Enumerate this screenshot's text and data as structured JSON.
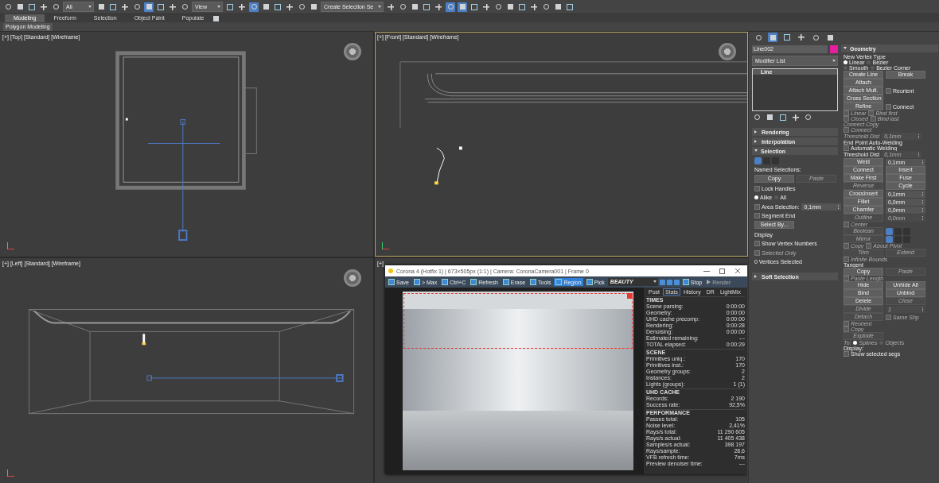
{
  "toolbar": {
    "selection_filter": "All",
    "reference_coord": "View",
    "named_selection": "Create Selection Se"
  },
  "ribbon": {
    "tabs": [
      {
        "label": "Modeling",
        "selected": true
      },
      {
        "label": "Freeform",
        "selected": false
      },
      {
        "label": "Selection",
        "selected": false
      },
      {
        "label": "Object Paint",
        "selected": false
      },
      {
        "label": "Populate",
        "selected": false
      }
    ],
    "panel": "Polygon Modeling"
  },
  "viewports": [
    {
      "kind": "top",
      "label": "[+] [Top] [Standard] [Wireframe]",
      "active": false
    },
    {
      "kind": "front",
      "label": "[+] [Front] [Standard] [Wireframe]",
      "active": true
    },
    {
      "kind": "left",
      "label": "[+] [Left] [Standard] [Wireframe]",
      "active": false
    },
    {
      "kind": "camera",
      "label": "[+]",
      "active": false
    }
  ],
  "command_panel": {
    "object_name": "Line002",
    "modifier_list": "Modifier List",
    "stack": [
      {
        "label": "Line",
        "selected": true
      }
    ],
    "rollouts_left": [
      {
        "title": "Rendering",
        "expanded": false
      },
      {
        "title": "Interpolation",
        "expanded": false
      },
      {
        "title": "Selection",
        "expanded": true,
        "rows": [
          {
            "items": [
              {
                "kind": "icons"
              }
            ]
          },
          {
            "items": [
              {
                "kind": "label",
                "text": "Named Selections:",
                "disabled": false
              }
            ]
          },
          {
            "items": [
              {
                "kind": "button",
                "text": "Copy",
                "disabled": false
              },
              {
                "kind": "button",
                "text": "Paste",
                "disabled": true
              }
            ]
          },
          {
            "items": [
              {
                "kind": "checkbox",
                "text": "Lock Handles",
                "checked": false,
                "disabled": false
              }
            ]
          },
          {
            "items": [
              {
                "kind": "radio",
                "text": "Alike",
                "selected": true,
                "disabled": false
              },
              {
                "kind": "radio",
                "text": "All",
                "selected": false,
                "disabled": false
              }
            ]
          },
          {
            "items": [
              {
                "kind": "checkbox",
                "text": "Area Selection:",
                "checked": false,
                "disabled": false
              },
              {
                "kind": "spinner",
                "text": "0,1mm",
                "disabled": false
              }
            ]
          },
          {
            "items": [
              {
                "kind": "checkbox",
                "text": "Segment End",
                "checked": false,
                "disabled": false
              }
            ]
          },
          {
            "items": [
              {
                "kind": "button",
                "text": "Select By...",
                "disabled": false
              }
            ]
          },
          {
            "items": [
              {
                "kind": "label",
                "text": "Display",
                "disabled": false
              }
            ]
          },
          {
            "items": [
              {
                "kind": "checkbox",
                "text": "Show Vertex Numbers",
                "checked": false,
                "disabled": false
              }
            ]
          },
          {
            "items": [
              {
                "kind": "checkbox",
                "text": "Selected Only",
                "checked": false,
                "disabled": true
              }
            ]
          },
          {
            "items": [
              {
                "kind": "label",
                "text": "0 Vertices Selected",
                "disabled": false
              }
            ]
          }
        ]
      },
      {
        "title": "Soft Selection",
        "expanded": false
      }
    ],
    "geometry": {
      "title": "Geometry",
      "expanded": true,
      "rows": [
        {
          "items": [
            {
              "kind": "label",
              "text": "New Vertex Type",
              "disabled": false
            }
          ]
        },
        {
          "items": [
            {
              "kind": "radio",
              "text": "Linear",
              "selected": true,
              "disabled": false
            },
            {
              "kind": "radio",
              "text": "Bezier",
              "selected": false,
              "disabled": false
            }
          ]
        },
        {
          "items": [
            {
              "kind": "radio",
              "text": "Smooth",
              "selected": false,
              "disabled": false
            },
            {
              "kind": "radio",
              "text": "Bezier Corner",
              "selected": false,
              "disabled": false
            }
          ]
        },
        {
          "items": [
            {
              "kind": "button",
              "text": "Create Line",
              "disabled": false
            },
            {
              "kind": "button",
              "text": "Break",
              "disabled": false
            }
          ]
        },
        {
          "items": [
            {
              "kind": "button",
              "text": "Attach",
              "disabled": false
            }
          ]
        },
        {
          "items": [
            {
              "kind": "button",
              "text": "Attach Mult.",
              "disabled": false
            },
            {
              "kind": "checkbox",
              "text": "Reorient",
              "checked": false,
              "disabled": false
            }
          ]
        },
        {
          "items": [
            {
              "kind": "button",
              "text": "Cross Section",
              "disabled": false
            }
          ]
        },
        {
          "items": [
            {
              "kind": "button",
              "text": "Refine",
              "disabled": false
            },
            {
              "kind": "checkbox",
              "text": "Connect",
              "checked": false,
              "disabled": false
            }
          ]
        },
        {
          "items": [
            {
              "kind": "checkbox",
              "text": "Linear",
              "checked": false,
              "disabled": true
            },
            {
              "kind": "checkbox",
              "text": "Bind first",
              "checked": false,
              "disabled": true
            }
          ]
        },
        {
          "items": [
            {
              "kind": "checkbox",
              "text": "Closed",
              "checked": false,
              "disabled": true
            },
            {
              "kind": "checkbox",
              "text": "Bind last",
              "checked": false,
              "disabled": true
            }
          ]
        },
        {
          "items": [
            {
              "kind": "label",
              "text": "Connect Copy",
              "disabled": true
            }
          ]
        },
        {
          "items": [
            {
              "kind": "checkbox",
              "text": "Connect",
              "checked": false,
              "disabled": true
            }
          ]
        },
        {
          "items": [
            {
              "kind": "label",
              "text": "Threshold Dist",
              "disabled": true
            },
            {
              "kind": "spinner",
              "text": "0,1mm",
              "disabled": true
            }
          ]
        },
        {
          "items": [
            {
              "kind": "label",
              "text": "End Point Auto-Welding",
              "disabled": false
            }
          ]
        },
        {
          "items": [
            {
              "kind": "checkbox",
              "text": "Automatic Welding",
              "checked": false,
              "disabled": false
            }
          ]
        },
        {
          "items": [
            {
              "kind": "label",
              "text": "Threshold Dist",
              "disabled": false
            },
            {
              "kind": "spinner",
              "text": "0,1mm",
              "disabled": true
            }
          ]
        },
        {
          "items": [
            {
              "kind": "button",
              "text": "Weld",
              "disabled": false
            },
            {
              "kind": "spinner",
              "text": "0,1mm",
              "disabled": false
            }
          ]
        },
        {
          "items": [
            {
              "kind": "button",
              "text": "Connect",
              "disabled": false
            },
            {
              "kind": "button",
              "text": "Insert",
              "disabled": false
            }
          ]
        },
        {
          "items": [
            {
              "kind": "button",
              "text": "Make First",
              "disabled": false
            },
            {
              "kind": "button",
              "text": "Fuse",
              "disabled": false
            }
          ]
        },
        {
          "items": [
            {
              "kind": "button",
              "text": "Reverse",
              "disabled": true
            },
            {
              "kind": "button",
              "text": "Cycle",
              "disabled": false
            }
          ]
        },
        {
          "items": [
            {
              "kind": "button",
              "text": "CrossInsert",
              "disabled": false
            },
            {
              "kind": "spinner",
              "text": "0,1mm",
              "disabled": false
            }
          ]
        },
        {
          "items": [
            {
              "kind": "button",
              "text": "Fillet",
              "disabled": false
            },
            {
              "kind": "spinner",
              "text": "0,0mm",
              "disabled": false
            }
          ]
        },
        {
          "items": [
            {
              "kind": "button",
              "text": "Chamfer",
              "disabled": false
            },
            {
              "kind": "spinner",
              "text": "0,0mm",
              "disabled": false
            }
          ]
        },
        {
          "items": [
            {
              "kind": "button",
              "text": "Outline",
              "disabled": true
            },
            {
              "kind": "spinner",
              "text": "0,0mm",
              "disabled": true
            }
          ]
        },
        {
          "items": [
            {
              "kind": "checkbox",
              "text": "Center",
              "checked": false,
              "disabled": true
            }
          ]
        },
        {
          "items": [
            {
              "kind": "button",
              "text": "Boolean",
              "disabled": true
            },
            {
              "kind": "icons"
            }
          ]
        },
        {
          "items": [
            {
              "kind": "button",
              "text": "Mirror",
              "disabled": true
            },
            {
              "kind": "icons"
            }
          ]
        },
        {
          "items": [
            {
              "kind": "checkbox",
              "text": "Copy",
              "checked": false,
              "disabled": true
            },
            {
              "kind": "checkbox",
              "text": "About Pivot",
              "checked": false,
              "disabled": true
            }
          ]
        },
        {
          "items": [
            {
              "kind": "button",
              "text": "Trim",
              "disabled": true
            },
            {
              "kind": "button",
              "text": "Extend",
              "disabled": true
            }
          ]
        },
        {
          "items": [
            {
              "kind": "checkbox",
              "text": "Infinite Bounds",
              "checked": false,
              "disabled": true
            }
          ]
        },
        {
          "items": [
            {
              "kind": "label",
              "text": "Tangent",
              "disabled": false
            }
          ]
        },
        {
          "items": [
            {
              "kind": "button",
              "text": "Copy",
              "disabled": false
            },
            {
              "kind": "button",
              "text": "Paste",
              "disabled": true
            }
          ]
        },
        {
          "items": [
            {
              "kind": "checkbox",
              "text": "Paste Length",
              "checked": false,
              "disabled": true
            }
          ]
        },
        {
          "items": [
            {
              "kind": "button",
              "text": "Hide",
              "disabled": false
            },
            {
              "kind": "button",
              "text": "Unhide All",
              "disabled": false
            }
          ]
        },
        {
          "items": [
            {
              "kind": "button",
              "text": "Bind",
              "disabled": false
            },
            {
              "kind": "button",
              "text": "Unbind",
              "disabled": false
            }
          ]
        },
        {
          "items": [
            {
              "kind": "button",
              "text": "Delete",
              "disabled": false
            },
            {
              "kind": "button",
              "text": "Close",
              "disabled": true
            }
          ]
        },
        {
          "items": [
            {
              "kind": "button",
              "text": "Divide",
              "disabled": true
            },
            {
              "kind": "spinner",
              "text": "1",
              "disabled": true
            }
          ]
        },
        {
          "items": [
            {
              "kind": "button",
              "text": "Detach",
              "disabled": true
            },
            {
              "kind": "checkbox",
              "text": "Same Shp",
              "checked": false,
              "disabled": true
            }
          ]
        },
        {
          "items": [
            {
              "kind": "checkbox",
              "text": "Reorient",
              "checked": false,
              "disabled": true
            }
          ]
        },
        {
          "items": [
            {
              "kind": "checkbox",
              "text": "Copy",
              "checked": false,
              "disabled": true
            }
          ]
        },
        {
          "items": [
            {
              "kind": "button",
              "text": "Explode",
              "disabled": true
            }
          ]
        },
        {
          "items": [
            {
              "kind": "label",
              "text": "To:",
              "disabled": true
            },
            {
              "kind": "radio",
              "text": "Splines",
              "selected": true,
              "disabled": true
            },
            {
              "kind": "radio",
              "text": "Objects",
              "selected": false,
              "disabled": true
            }
          ]
        },
        {
          "items": [
            {
              "kind": "label",
              "text": "Display:",
              "disabled": false
            }
          ]
        },
        {
          "items": [
            {
              "kind": "checkbox",
              "text": "Show selected segs",
              "checked": false,
              "disabled": false
            }
          ]
        }
      ]
    }
  },
  "render_window": {
    "title": "Corona 4 (Hotfix 1) | 673×505px (1:1) | Camera: CoronaCamera001 | Frame 0",
    "tools": [
      {
        "label": "Save",
        "selected": false
      },
      {
        "label": "> Max",
        "selected": false
      },
      {
        "label": "Ctrl+C",
        "selected": false
      },
      {
        "label": "Refresh",
        "selected": false
      },
      {
        "label": "Erase",
        "selected": false
      },
      {
        "label": "Tools",
        "selected": false
      },
      {
        "label": "Region",
        "selected": true
      },
      {
        "label": "Pick",
        "selected": false
      }
    ],
    "channel": "BEAUTY",
    "stop": "Stop",
    "render": "Render",
    "tabs": [
      {
        "label": "Post",
        "selected": false
      },
      {
        "label": "Stats",
        "selected": true
      },
      {
        "label": "History",
        "selected": false
      },
      {
        "label": "DR",
        "selected": false
      },
      {
        "label": "LightMix",
        "selected": false
      }
    ],
    "stats": [
      {
        "title": "TIMES",
        "rows": [
          {
            "label": "Scene parsing:",
            "value": "0:00:00"
          },
          {
            "label": "Geometry:",
            "value": "0:00:00"
          },
          {
            "label": "UHD cache precomp:",
            "value": "0:00:00"
          },
          {
            "label": "Rendering:",
            "value": "0:00:28"
          },
          {
            "label": "Denoising:",
            "value": "0:00:00"
          },
          {
            "label": "Estimated remaining:",
            "value": "---"
          },
          {
            "label": "TOTAL elapsed:",
            "value": "0:00:29"
          }
        ]
      },
      {
        "title": "SCENE",
        "rows": [
          {
            "label": "Primitives uniq.:",
            "value": "170"
          },
          {
            "label": "Primitives inst.:",
            "value": "170"
          },
          {
            "label": "Geometry groups:",
            "value": "2"
          },
          {
            "label": "Instances:",
            "value": "2"
          },
          {
            "label": "Lights (groups):",
            "value": "1 (1)"
          }
        ]
      },
      {
        "title": "UHD CACHE",
        "rows": [
          {
            "label": "Records:",
            "value": "2 190"
          },
          {
            "label": "Success rate:",
            "value": "92,5%"
          }
        ]
      },
      {
        "title": "PERFORMANCE",
        "rows": [
          {
            "label": "Passes total:",
            "value": "105"
          },
          {
            "label": "Noise level:",
            "value": "2,41%"
          },
          {
            "label": "Rays/s total:",
            "value": "11 290 605"
          },
          {
            "label": "Rays/s actual:",
            "value": "11 405 438"
          },
          {
            "label": "Samples/s actual:",
            "value": "398 197"
          },
          {
            "label": "Rays/sample:",
            "value": "28,6"
          },
          {
            "label": "VFB refresh time:",
            "value": "7ms"
          },
          {
            "label": "Preview denoiser time:",
            "value": "---"
          }
        ]
      }
    ]
  }
}
